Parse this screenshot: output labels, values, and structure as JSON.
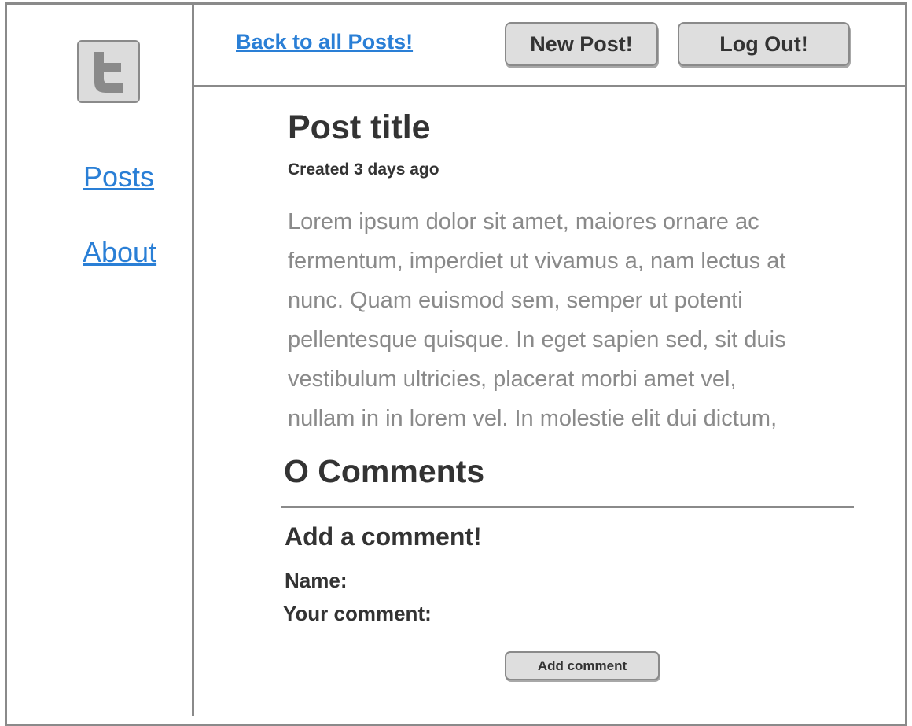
{
  "sidebar": {
    "logo_icon": "twitter-t-icon",
    "links": {
      "posts": "Posts",
      "about": "About"
    }
  },
  "header": {
    "back_link": "Back to all Posts!",
    "new_post_button": "New Post!",
    "logout_button": "Log Out!"
  },
  "post": {
    "title": "Post title",
    "created": "Created 3 days ago",
    "body_lines": [
      "Lorem ipsum dolor sit amet, maiores ornare ac",
      "fermentum, imperdiet ut vivamus a, nam lectus at",
      "nunc. Quam euismod sem, semper ut potenti",
      "pellentesque quisque. In eget sapien sed, sit duis",
      "vestibulum ultricies, placerat morbi amet vel,",
      "nullam in in lorem vel. In molestie elit dui dictum,"
    ]
  },
  "comments": {
    "heading": "O Comments",
    "form": {
      "heading": "Add a comment!",
      "name_label": "Name:",
      "comment_label": "Your comment:",
      "submit_label": "Add comment"
    }
  },
  "colors": {
    "link": "#2a7fd6",
    "border": "#8a8a8a",
    "button_bg": "#dedede",
    "body_text": "#8a8a8a",
    "heading_text": "#333333"
  }
}
